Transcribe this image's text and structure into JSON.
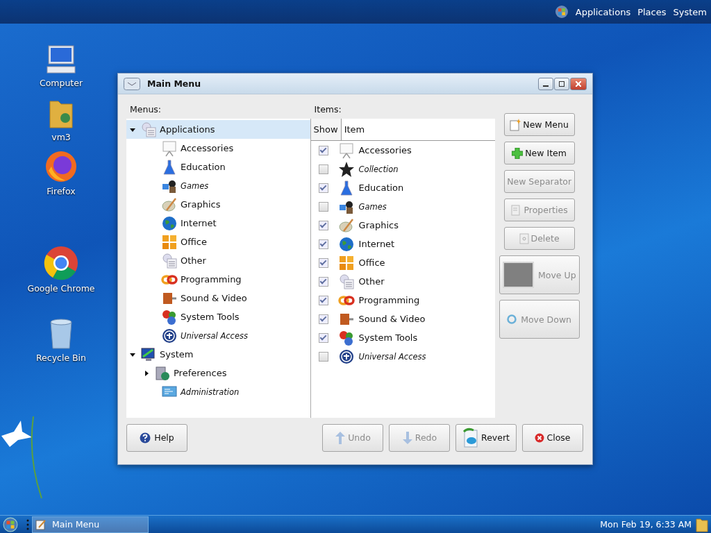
{
  "top_panel": {
    "menus": [
      "Applications",
      "Places",
      "System"
    ]
  },
  "desktop_icons": [
    {
      "label": "Computer"
    },
    {
      "label": "vm3"
    },
    {
      "label": "Firefox"
    },
    {
      "label": "Google Chrome"
    },
    {
      "label": "Recycle Bin"
    }
  ],
  "window": {
    "title": "Main Menu",
    "menus_label": "Menus:",
    "items_label": "Items:",
    "menu_tree": [
      {
        "label": "Applications",
        "expanded": true,
        "selected": true,
        "hidden": false,
        "children": [
          {
            "label": "Accessories",
            "selected": false,
            "hidden": false
          },
          {
            "label": "Education",
            "selected": false,
            "hidden": false
          },
          {
            "label": "Games",
            "selected": false,
            "hidden": true
          },
          {
            "label": "Graphics",
            "selected": false,
            "hidden": false
          },
          {
            "label": "Internet",
            "selected": false,
            "hidden": false
          },
          {
            "label": "Office",
            "selected": false,
            "hidden": false
          },
          {
            "label": "Other",
            "selected": false,
            "hidden": false
          },
          {
            "label": "Programming",
            "selected": false,
            "hidden": false
          },
          {
            "label": "Sound & Video",
            "selected": false,
            "hidden": false
          },
          {
            "label": "System Tools",
            "selected": false,
            "hidden": false
          },
          {
            "label": "Universal Access",
            "selected": false,
            "hidden": true
          }
        ]
      },
      {
        "label": "System",
        "expanded": true,
        "selected": false,
        "hidden": false,
        "children": [
          {
            "label": "Preferences",
            "expanded": false,
            "selected": false,
            "hidden": false
          },
          {
            "label": "Administration",
            "selected": false,
            "hidden": true
          }
        ]
      }
    ],
    "items_table": {
      "columns": [
        "Show",
        "Item"
      ],
      "rows": [
        {
          "show": true,
          "label": "Accessories",
          "hidden": false
        },
        {
          "show": false,
          "label": "Collection",
          "hidden": true
        },
        {
          "show": true,
          "label": "Education",
          "hidden": false
        },
        {
          "show": false,
          "label": "Games",
          "hidden": true
        },
        {
          "show": true,
          "label": "Graphics",
          "hidden": false
        },
        {
          "show": true,
          "label": "Internet",
          "hidden": false
        },
        {
          "show": true,
          "label": "Office",
          "hidden": false
        },
        {
          "show": true,
          "label": "Other",
          "hidden": false
        },
        {
          "show": true,
          "label": "Programming",
          "hidden": false
        },
        {
          "show": true,
          "label": "Sound & Video",
          "hidden": false
        },
        {
          "show": true,
          "label": "System Tools",
          "hidden": false
        },
        {
          "show": false,
          "label": "Universal Access",
          "hidden": true
        }
      ]
    },
    "side_buttons": [
      {
        "label": "New Menu",
        "disabled": false
      },
      {
        "label": "New Item",
        "disabled": false
      },
      {
        "label": "New Separator",
        "disabled": true
      },
      {
        "label": "Properties",
        "disabled": true
      },
      {
        "label": "Delete",
        "disabled": true
      }
    ],
    "move_buttons": [
      {
        "label": "Move Up",
        "disabled": true
      },
      {
        "label": "Move Down",
        "disabled": true
      }
    ],
    "help_button": {
      "label": "Help",
      "disabled": false
    },
    "footer_buttons": [
      {
        "label": "Undo",
        "disabled": true
      },
      {
        "label": "Redo",
        "disabled": true
      },
      {
        "label": "Revert",
        "disabled": false
      },
      {
        "label": "Close",
        "disabled": false
      }
    ]
  },
  "taskbar": {
    "tasks": [
      {
        "label": "Main Menu",
        "selected": true
      }
    ],
    "clock": "Mon Feb 19, 6:33 AM"
  }
}
